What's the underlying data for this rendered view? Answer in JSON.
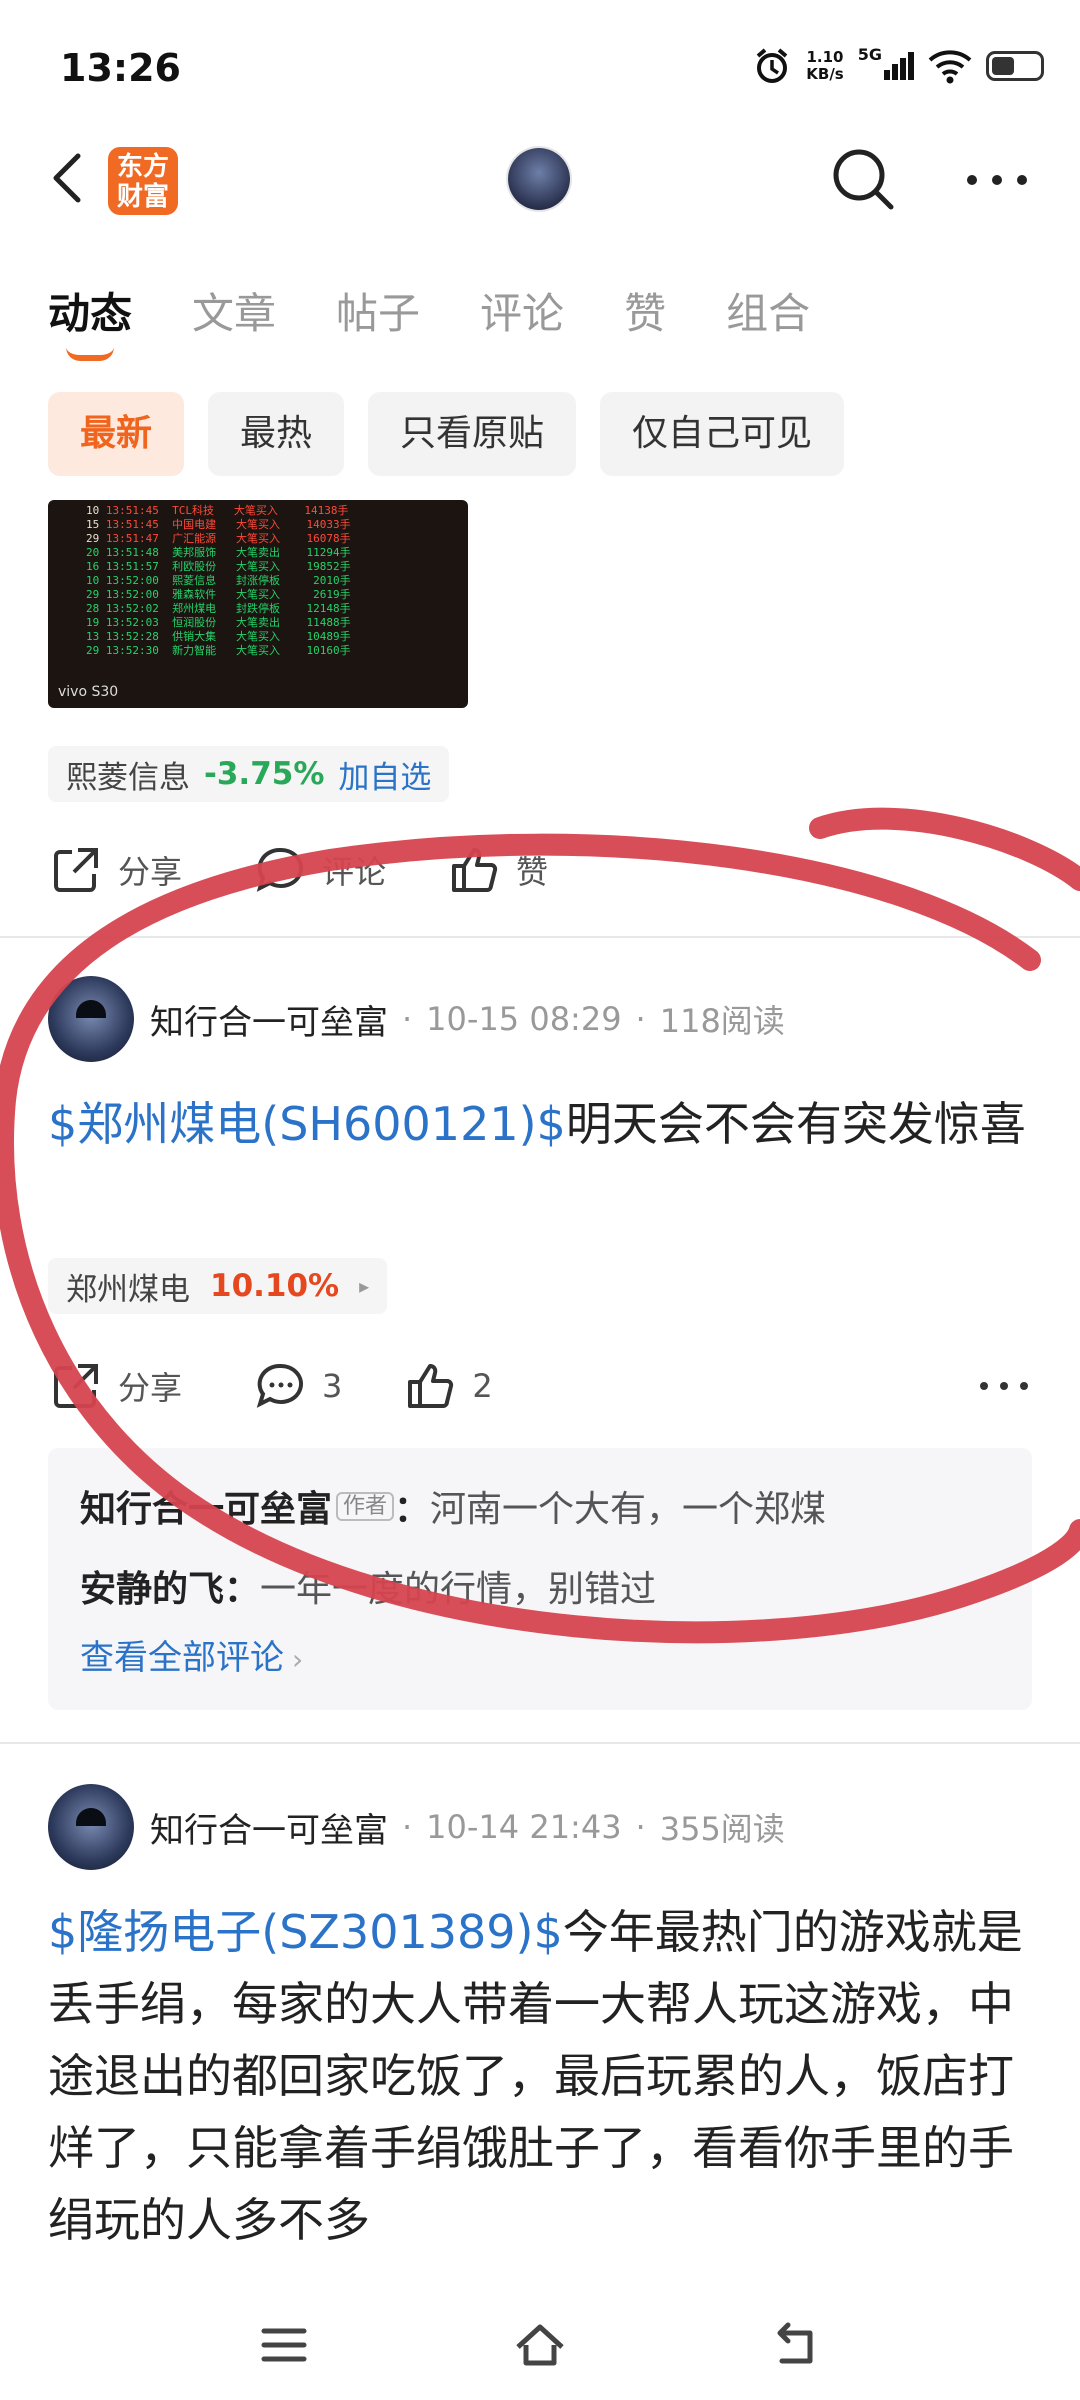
{
  "status": {
    "time": "13:26",
    "speed_value": "1.10",
    "speed_unit": "KB/s",
    "network": "5G"
  },
  "header": {
    "logo_line1": "东方",
    "logo_line2": "财富"
  },
  "tabs": [
    {
      "label": "动态",
      "active": true
    },
    {
      "label": "文章"
    },
    {
      "label": "帖子"
    },
    {
      "label": "评论"
    },
    {
      "label": "赞"
    },
    {
      "label": "组合"
    }
  ],
  "filters": [
    {
      "label": "最新",
      "active": true
    },
    {
      "label": "最热"
    },
    {
      "label": "只看原贴"
    },
    {
      "label": "仅自己可见"
    }
  ],
  "prev_post": {
    "photo_brand": "vivo S30",
    "stock": {
      "name": "熙菱信息",
      "change": "-3.75%",
      "action": "加自选"
    },
    "actions": {
      "share": "分享",
      "comment": "评论",
      "like": "赞"
    }
  },
  "post1": {
    "author": "知行合一可垒富",
    "time": "10-15 08:29",
    "reads": "118阅读",
    "stock_link": "$郑州煤电(SH600121)$",
    "text": "明天会不会有突发惊喜",
    "stock": {
      "name": "郑州煤电",
      "change": "10.10%"
    },
    "share_label": "分享",
    "comment_count": "3",
    "like_count": "2",
    "comments": [
      {
        "user": "知行合一可垒富",
        "tag": "作者",
        "text": "河南一个大有，一个郑煤"
      },
      {
        "user": "安静的飞",
        "text": "一年一度的行情，别错过"
      }
    ],
    "view_all": "查看全部评论"
  },
  "post2": {
    "author": "知行合一可垒富",
    "time": "10-14 21:43",
    "reads": "355阅读",
    "stock_link": "$隆扬电子(SZ301389)$",
    "text": "今年最热门的游戏就是丢手绢，每家的大人带着一大帮人玩这游戏，中途退出的都回家吃饭了，最后玩累的人，饭店打烊了，只能拿着手绢饿肚子了，看看你手里的手绢玩的人多不多"
  },
  "colors": {
    "accent": "#f06a23",
    "link": "#2b73c8",
    "gain": "#e5471e",
    "loss": "#2aa85a",
    "annotation": "#d6454f"
  }
}
